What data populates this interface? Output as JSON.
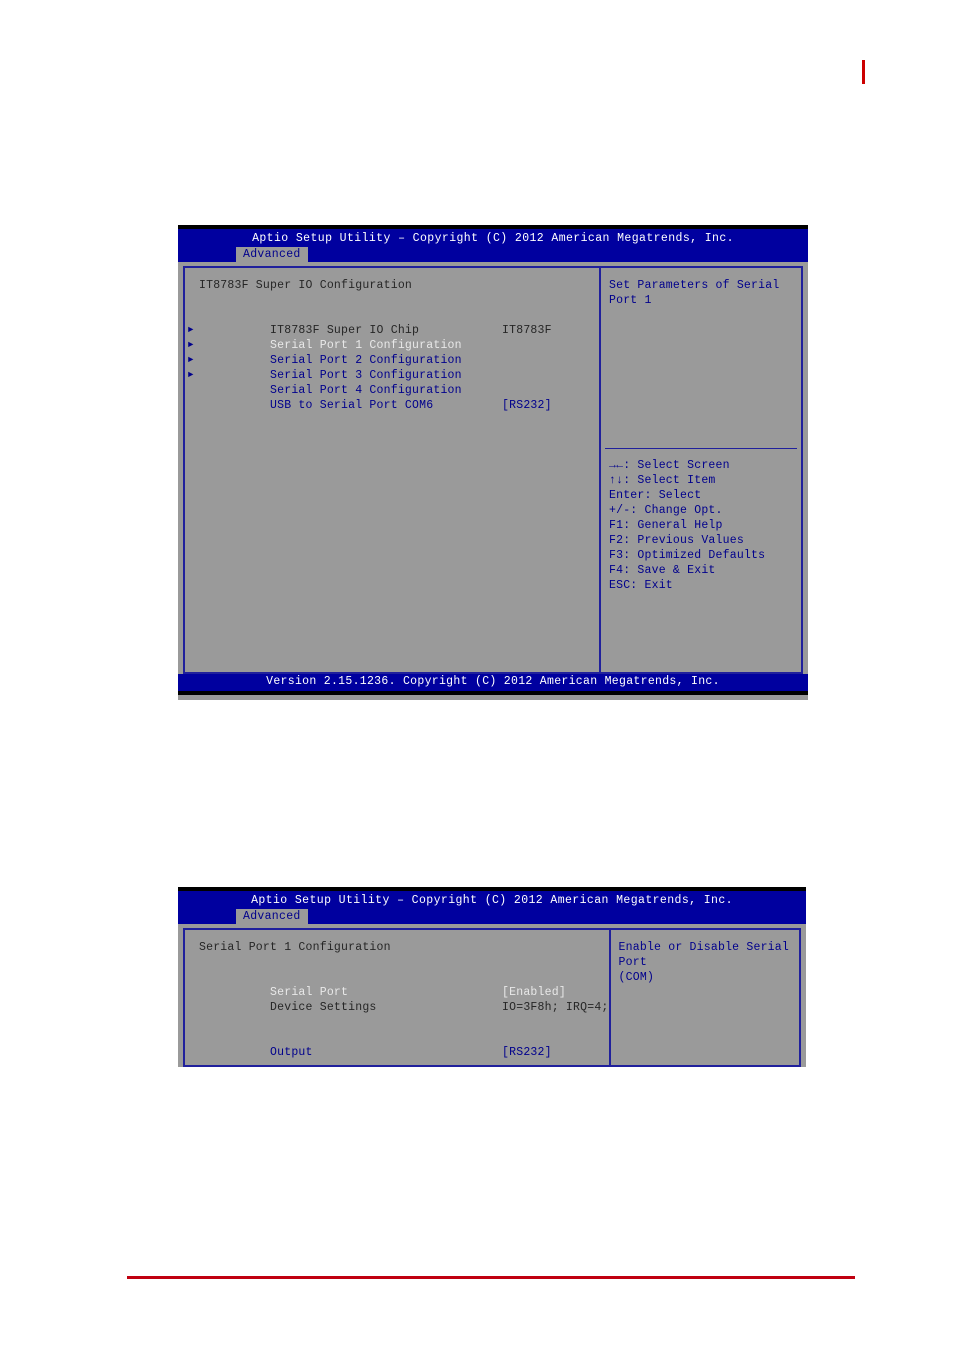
{
  "page": {
    "top_mark_color": "#cc0000",
    "bottom_rule_color": "#c00010"
  },
  "screens": [
    {
      "id": "super-io-configuration",
      "titlebar": "Aptio Setup Utility – Copyright (C) 2012 American Megatrends, Inc.",
      "tab": "Advanced",
      "section_title": "IT8783F Super IO Configuration",
      "rows": [
        {
          "label": "IT8783F Super IO Chip",
          "value": "IT8783F",
          "style": "dark",
          "arrow": false
        },
        {
          "label": "Serial Port 1 Configuration",
          "value": "",
          "style": "white",
          "arrow": true
        },
        {
          "label": "Serial Port 2 Configuration",
          "value": "",
          "style": "blue",
          "arrow": true
        },
        {
          "label": "Serial Port 3 Configuration",
          "value": "",
          "style": "blue",
          "arrow": true
        },
        {
          "label": "Serial Port 4 Configuration",
          "value": "",
          "style": "blue",
          "arrow": true
        },
        {
          "label": "USB to Serial Port COM6",
          "value": "[RS232]",
          "style": "blue",
          "arrow": false
        }
      ],
      "help": "Set Parameters of Serial Port 1",
      "keys": [
        "→←: Select Screen",
        "↑↓: Select Item",
        "Enter: Select",
        "+/-: Change Opt.",
        "F1: General Help",
        "F2: Previous Values",
        "F3: Optimized Defaults",
        "F4: Save & Exit",
        "ESC: Exit"
      ],
      "footer": "Version 2.15.1236. Copyright (C) 2012 American Megatrends, Inc."
    },
    {
      "id": "serial-port-1-configuration",
      "titlebar": "Aptio Setup Utility – Copyright (C) 2012 American Megatrends, Inc.",
      "tab": "Advanced",
      "section_title": "Serial Port 1 Configuration",
      "rows": [
        {
          "label": "Serial Port",
          "value": "[Enabled]",
          "style": "white",
          "arrow": false
        },
        {
          "label": "Device Settings",
          "value": "IO=3F8h; IRQ=4;",
          "style": "dark",
          "arrow": false
        },
        {
          "label": "",
          "value": "",
          "style": "dark",
          "arrow": false
        },
        {
          "label": "",
          "value": "",
          "style": "dark",
          "arrow": false
        },
        {
          "label": "Output",
          "value": "[RS232]",
          "style": "blue",
          "arrow": false
        }
      ],
      "help": "Enable or Disable Serial Port\n(COM)"
    }
  ]
}
